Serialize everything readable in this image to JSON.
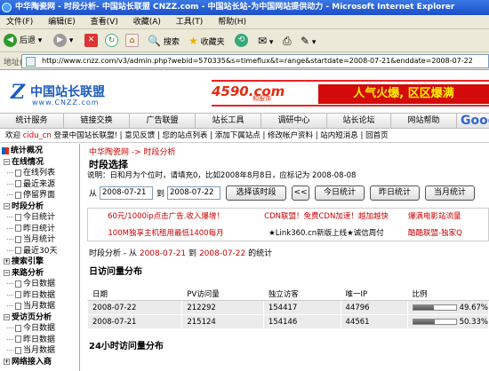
{
  "window": {
    "title": "中华陶瓷网 - 时段分析- 中国站长联盟 CNZZ.com - 中国站长站-为中国网站提供动力 - Microsoft Internet Explorer"
  },
  "menu": [
    "文件(F)",
    "编辑(E)",
    "查看(V)",
    "收藏(A)",
    "工具(T)",
    "帮助(H)"
  ],
  "toolbar": {
    "back": "后退",
    "search": "搜索",
    "favorites": "收藏夹"
  },
  "address": {
    "label": "地址(D)",
    "url": "http://www.cnzz.com/v3/admin.php?webid=570335&s=timeflux&t=range&startdate=2008-07-21&enddate=2008-07-22"
  },
  "logo": {
    "title": "中国站长联盟",
    "domain": "www.CNZZ.com"
  },
  "banner": {
    "brand": "4590.com",
    "brand_sub": "和服饰",
    "slogan": "人气火爆, 区区爆满"
  },
  "nav": [
    "统计服务",
    "链接交换",
    "广告联盟",
    "站长工具",
    "调研中心",
    "站长论坛",
    "网站帮助"
  ],
  "nav_google": "Goog",
  "welcome": {
    "prefix": "欢迎",
    "user": "cidu_cn",
    "links": "登录中国站长联盟!  |  意见反馈  |  您的站点列表  |  添加下属站点  |  修改帐户资料  |  站内短消息  |  回首页"
  },
  "sidebar": [
    {
      "label": "统计概况",
      "kind": "root"
    },
    {
      "label": "在线情况",
      "kind": "group"
    },
    {
      "label": "在线列表",
      "kind": "item"
    },
    {
      "label": "最近来源",
      "kind": "item"
    },
    {
      "label": "停留界面",
      "kind": "item"
    },
    {
      "label": "时段分析",
      "kind": "group"
    },
    {
      "label": "今日统计",
      "kind": "item"
    },
    {
      "label": "昨日统计",
      "kind": "item"
    },
    {
      "label": "当月统计",
      "kind": "item"
    },
    {
      "label": "最近30天",
      "kind": "item"
    },
    {
      "label": "搜索引擎",
      "kind": "group"
    },
    {
      "label": "来路分析",
      "kind": "group"
    },
    {
      "label": "今日数据",
      "kind": "item"
    },
    {
      "label": "昨日数据",
      "kind": "item"
    },
    {
      "label": "当月数据",
      "kind": "item"
    },
    {
      "label": "受访页分析",
      "kind": "group"
    },
    {
      "label": "今日数据",
      "kind": "item"
    },
    {
      "label": "昨日数据",
      "kind": "item"
    },
    {
      "label": "当月数据",
      "kind": "item"
    },
    {
      "label": "网络接入商",
      "kind": "group"
    }
  ],
  "main": {
    "breadcrumb": "中华陶瓷网 -> 时段分析",
    "title": "时段选择",
    "description": "说明：日和月为个位时，请填充0，比如2008年8月8日，应标记为 2008-08-08",
    "from_label": "从",
    "from_date": "2008-07-21",
    "to_label": "到",
    "to_date": "2008-07-22",
    "choose_btn": "选择该时段",
    "prev_btn": "<<",
    "today_btn": "今日统计",
    "yesterday_btn": "昨日统计",
    "month_btn": "当月统计",
    "ads": [
      {
        "text": "60元/1000ip点击广告.收入爆增！",
        "color": "#c00"
      },
      {
        "text": "CDN联盟！免费CDN加速！越加越快",
        "color": "#c00"
      },
      {
        "text": "爆满电影站流量",
        "color": "#c00"
      },
      {
        "text": "100M独享主机租用最低1400每月",
        "color": "#c00"
      },
      {
        "text": "★Link360.cn新版上线★诚信周付",
        "color": "#000"
      },
      {
        "text": "酷酷联盟-独家Q",
        "color": "#c00"
      }
    ],
    "stat_prefix": "时段分析 - 从",
    "stat_from": "2008-07-21",
    "stat_mid": "到",
    "stat_to": "2008-07-22",
    "stat_suffix": "的统计",
    "daily_title": "日访问量分布",
    "table_headers": [
      "日期",
      "PV访问量",
      "独立访客",
      "唯一IP",
      "比例"
    ],
    "rows": [
      {
        "date": "2008-07-22",
        "pv": "212292",
        "uv": "154417",
        "ip": "44796",
        "ratio": "49.67%",
        "pct": 49.67
      },
      {
        "date": "2008-07-21",
        "pv": "215124",
        "uv": "154146",
        "ip": "44561",
        "ratio": "50.33%",
        "pct": 50.33
      }
    ],
    "hourly_title": "24小时访问量分布"
  }
}
